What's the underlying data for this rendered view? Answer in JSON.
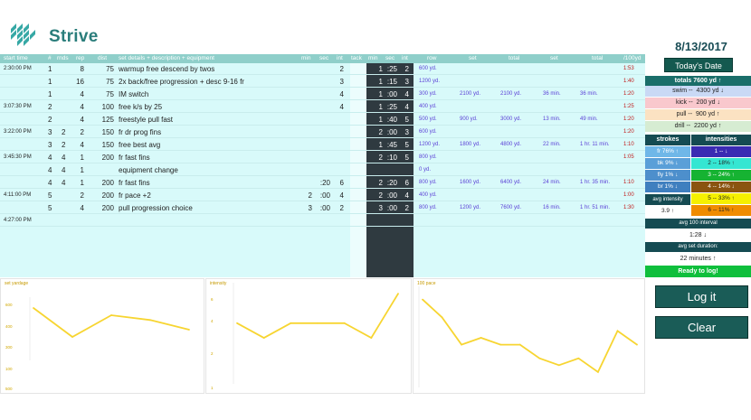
{
  "app": {
    "title": "Strive",
    "date": "8/13/2017"
  },
  "columns": {
    "start_time": "start time",
    "num": "#",
    "rnds": "rnds",
    "rep": "rep",
    "dist": "dist",
    "details": "set details + description + equipment",
    "min": "min",
    "sec": "sec",
    "int": "int",
    "tack": "tack",
    "min2": "min",
    "sec2": "sec",
    "int2": "int",
    "row": "row",
    "set": "set",
    "total": "total",
    "set2": "set",
    "total2": "total",
    "per100": "/100yd"
  },
  "rows": [
    {
      "start": "2:30:00 PM",
      "num": "1",
      "rnds": "",
      "rep": "8",
      "dist": "75",
      "desc": "warmup free descend by twos",
      "min": "",
      "sec": "",
      "int": "2",
      "m2": "1",
      "s2": ":25",
      "i2": "2",
      "row": "600 yd.",
      "set": "",
      "total": "",
      "set2": "",
      "total2": "",
      "p100": "1:53"
    },
    {
      "start": "",
      "num": "1",
      "rnds": "",
      "rep": "16",
      "dist": "75",
      "desc": "2x back/free progression + desc 9-16 fr",
      "min": "",
      "sec": "",
      "int": "3",
      "m2": "1",
      "s2": ":15",
      "i2": "3",
      "row": "1200 yd.",
      "set": "",
      "total": "",
      "set2": "",
      "total2": "",
      "p100": "1:40"
    },
    {
      "start": "",
      "num": "1",
      "rnds": "",
      "rep": "4",
      "dist": "75",
      "desc": "IM switch",
      "min": "",
      "sec": "",
      "int": "4",
      "m2": "1",
      "s2": ":00",
      "i2": "4",
      "row": "300 yd.",
      "set": "2100 yd.",
      "total": "2100 yd.",
      "set2": "36 min.",
      "total2": "36 min.",
      "p100": "1:20"
    },
    {
      "start": "3:07:30 PM",
      "num": "2",
      "rnds": "",
      "rep": "4",
      "dist": "100",
      "desc": "free k/s by 25",
      "min": "",
      "sec": "",
      "int": "4",
      "m2": "1",
      "s2": ":25",
      "i2": "4",
      "row": "400 yd.",
      "set": "",
      "total": "",
      "set2": "",
      "total2": "",
      "p100": "1:25"
    },
    {
      "start": "",
      "num": "2",
      "rnds": "",
      "rep": "4",
      "dist": "125",
      "desc": "freestyle pull fast",
      "min": "",
      "sec": "",
      "int": "",
      "m2": "1",
      "s2": ":40",
      "i2": "5",
      "row": "500 yd.",
      "set": "900 yd.",
      "total": "3000 yd.",
      "set2": "13 min.",
      "total2": "49 min.",
      "p100": "1:20"
    },
    {
      "start": "3:22:00 PM",
      "num": "3",
      "rnds": "2",
      "rep": "2",
      "dist": "150",
      "desc": "fr dr prog fins",
      "min": "",
      "sec": "",
      "int": "",
      "m2": "2",
      "s2": ":00",
      "i2": "3",
      "row": "600 yd.",
      "set": "",
      "total": "",
      "set2": "",
      "total2": "",
      "p100": "1:20"
    },
    {
      "start": "",
      "num": "3",
      "rnds": "2",
      "rep": "4",
      "dist": "150",
      "desc": "free best avg",
      "min": "",
      "sec": "",
      "int": "",
      "m2": "1",
      "s2": ":45",
      "i2": "5",
      "row": "1200 yd.",
      "set": "1800 yd.",
      "total": "4800 yd.",
      "set2": "22 min.",
      "total2": "1 hr. 11 min.",
      "p100": "1:10"
    },
    {
      "start": "3:45:30 PM",
      "num": "4",
      "rnds": "4",
      "rep": "1",
      "dist": "200",
      "desc": "fr fast fins",
      "min": "",
      "sec": "",
      "int": "",
      "m2": "2",
      "s2": ":10",
      "i2": "5",
      "row": "800 yd.",
      "set": "",
      "total": "",
      "set2": "",
      "total2": "",
      "p100": "1:05"
    },
    {
      "start": "",
      "num": "4",
      "rnds": "4",
      "rep": "1",
      "dist": "",
      "desc": "equipment change",
      "min": "",
      "sec": "",
      "int": "",
      "m2": "",
      "s2": "",
      "i2": "",
      "row": "0 yd.",
      "set": "",
      "total": "",
      "set2": "",
      "total2": "",
      "p100": ""
    },
    {
      "start": "",
      "num": "4",
      "rnds": "4",
      "rep": "1",
      "dist": "200",
      "desc": "fr fast fins",
      "min": "",
      "sec": ":20",
      "int": "6",
      "m2": "2",
      "s2": ":20",
      "i2": "6",
      "row": "800 yd.",
      "set": "1600 yd.",
      "total": "6400 yd.",
      "set2": "24 min.",
      "total2": "1 hr. 35 min.",
      "p100": "1:10"
    },
    {
      "start": "4:11:00 PM",
      "num": "5",
      "rnds": "",
      "rep": "2",
      "dist": "200",
      "desc": "fr pace +2",
      "min": "2",
      "sec": ":00",
      "int": "4",
      "m2": "2",
      "s2": ":00",
      "i2": "4",
      "row": "400 yd.",
      "set": "",
      "total": "",
      "set2": "",
      "total2": "",
      "p100": "1:00"
    },
    {
      "start": "",
      "num": "5",
      "rnds": "",
      "rep": "4",
      "dist": "200",
      "desc": "pull progression choice",
      "min": "3",
      "sec": ":00",
      "int": "2",
      "m2": "3",
      "s2": ":00",
      "i2": "2",
      "row": "800 yd.",
      "set": "1200 yd.",
      "total": "7600 yd.",
      "set2": "16 min.",
      "total2": "1 hr. 51 min.",
      "p100": "1:30"
    },
    {
      "start": "4:27:00 PM",
      "num": "",
      "rnds": "",
      "rep": "",
      "dist": "",
      "desc": "",
      "min": "",
      "sec": "",
      "int": "",
      "m2": "",
      "s2": "",
      "i2": "",
      "row": "",
      "set": "",
      "total": "",
      "set2": "",
      "total2": "",
      "p100": ""
    }
  ],
  "panel": {
    "date_button": "Today's Date",
    "totals": "totals 7600 yd ↑",
    "swim": {
      "label": "swim --",
      "value": "4300 yd ↓",
      "color": "#c9d9f5"
    },
    "kick": {
      "label": "kick --",
      "value": "200 yd ↓",
      "color": "#f9c8cd"
    },
    "pull": {
      "label": "pull --",
      "value": "900 yd ↑",
      "color": "#fbe2c2"
    },
    "drill": {
      "label": "drill --",
      "value": "2200 yd ↑",
      "color": "#d6ecd2"
    },
    "strokes_header": "strokes",
    "intensities_header": "intensities",
    "strokes": [
      {
        "text": "fr 76% ↑",
        "color": "#6fb7e8"
      },
      {
        "text": "bk 9% ↓",
        "color": "#5a9fd8"
      },
      {
        "text": "fly 1% ↓",
        "color": "#4d8fcc"
      },
      {
        "text": "br 1% ↓",
        "color": "#3f7fbf"
      }
    ],
    "intensities": [
      {
        "text": "1 -- ↓",
        "color": "#3a2bb3",
        "text_color": "#ffffff"
      },
      {
        "text": "2 -- 18% ↑",
        "color": "#35e6d2",
        "text_color": "#222222"
      },
      {
        "text": "3 -- 24% ↑",
        "color": "#16b332",
        "text_color": "#ffffff"
      },
      {
        "text": "4 -- 14% ↓",
        "color": "#8a5410",
        "text_color": "#ffffff"
      },
      {
        "text": "5 -- 33% ↑",
        "color": "#f5f000",
        "text_color": "#222222"
      },
      {
        "text": "6 -- 11% ↑",
        "color": "#f08c00",
        "text_color": "#222222"
      }
    ],
    "avg_intensity_label": "avg intensity",
    "avg_intensity_value": "3.9 ↑",
    "avg_interval_label": "avg 100 interval",
    "avg_interval_value": "1:28 ↓",
    "avg_set_label": "avg set duration:",
    "avg_set_value": "22 minutes ↑",
    "ready": "Ready to log!"
  },
  "actions": {
    "log": "Log it",
    "clear": "Clear"
  },
  "charts": {
    "line_color": "#f7d531",
    "title_color": "#c69a00"
  },
  "chart_data": [
    {
      "type": "line",
      "title": "set yardage",
      "x": [
        1,
        2,
        3,
        4,
        5
      ],
      "values": [
        2100,
        900,
        1800,
        1600,
        1200
      ],
      "ylim": [
        0,
        2400
      ],
      "yticks": [
        "600",
        "400",
        "300",
        "100",
        "500"
      ]
    },
    {
      "type": "line",
      "title": "intensity",
      "x": [
        1,
        2,
        3,
        4,
        5,
        6,
        7
      ],
      "values": [
        4.0,
        3.0,
        4.0,
        4.0,
        4.0,
        3.0,
        6.0
      ],
      "ylim": [
        0,
        6.5
      ],
      "yticks": [
        "6",
        "4",
        "2",
        "1"
      ]
    },
    {
      "type": "line",
      "title": "100 pace",
      "x": [
        1,
        2,
        3,
        4,
        5,
        6,
        7,
        8,
        9,
        10,
        11,
        12
      ],
      "values": [
        113,
        100,
        80,
        85,
        80,
        80,
        70,
        65,
        70,
        60,
        90,
        80
      ],
      "ylim": [
        50,
        120
      ],
      "yticks": []
    }
  ]
}
